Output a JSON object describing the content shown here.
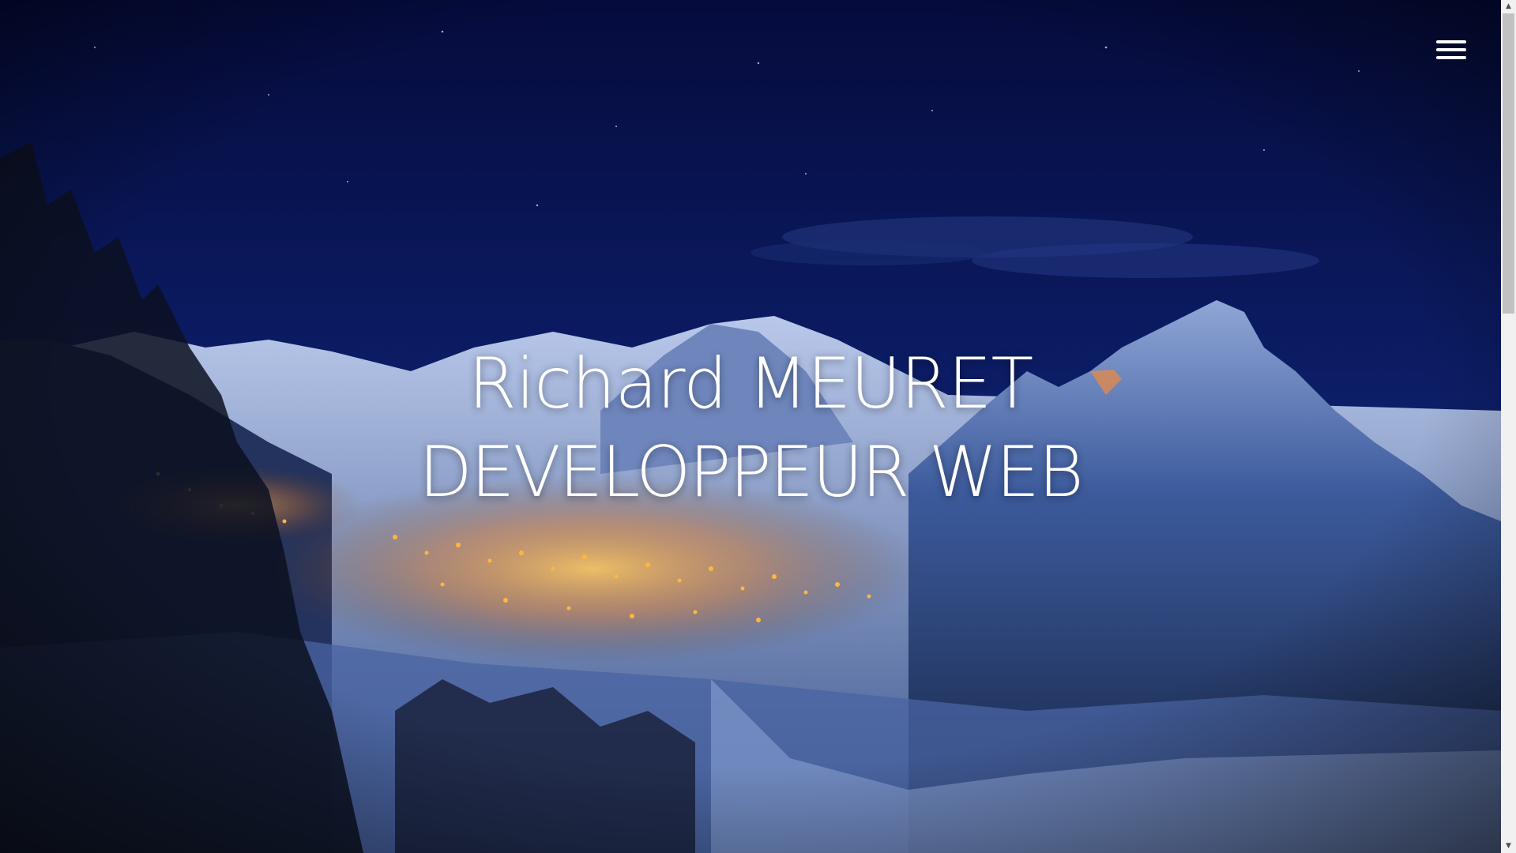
{
  "hero": {
    "name": "Richard MEURET",
    "role": "DEVELOPPEUR WEB",
    "background_image": "snowy mountain village at night"
  },
  "nav": {
    "menu_icon": "hamburger-menu-icon"
  },
  "scrollbar": {
    "up_arrow": "▲",
    "down_arrow": "▼"
  },
  "colors": {
    "sky_top": "#070f48",
    "sky_mid": "#0f2270",
    "text": "#ffffff",
    "village_lights": "#ffb640"
  }
}
